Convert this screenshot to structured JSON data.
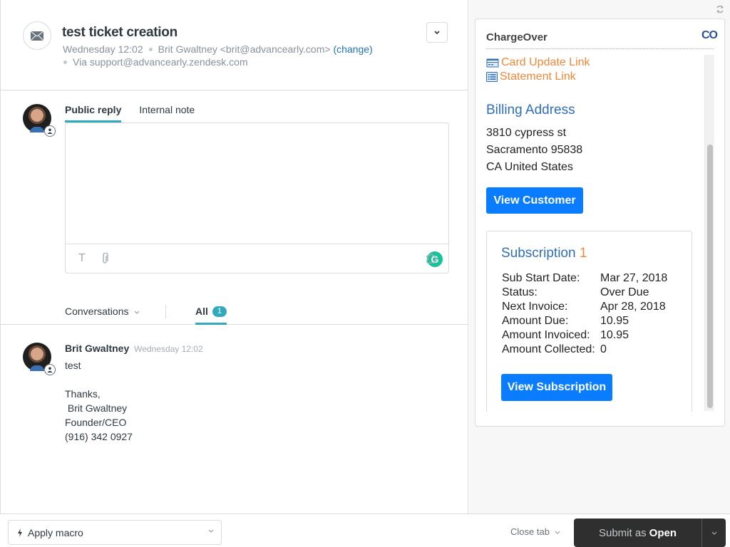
{
  "ticket": {
    "title": "test ticket creation",
    "date": "Wednesday 12:02",
    "requester": "Brit Gwaltney <brit@advancearly.com>",
    "change_label": "(change)",
    "via": "Via support@advancearly.zendesk.com",
    "channel_icon": "envelope-icon"
  },
  "composer": {
    "tabs": [
      {
        "label": "Public reply",
        "active": true
      },
      {
        "label": "Internal note",
        "active": false
      }
    ],
    "body": "",
    "tools": [
      "text-format-icon",
      "attachment-icon",
      "apps-puzzle-icon"
    ]
  },
  "conversations": {
    "filter_label": "Conversations",
    "all_label": "All",
    "all_count": "1"
  },
  "messages": [
    {
      "author": "Brit Gwaltney",
      "time": "Wednesday 12:02",
      "body": "test\n\nThanks,\n Brit Gwaltney\nFounder/CEO\n(916) 342 0927"
    }
  ],
  "app": {
    "title": "ChargeOver",
    "logo": "CO",
    "links": [
      {
        "label": "Card Update Link",
        "icon": "credit-card-icon"
      },
      {
        "label": "Statement Link",
        "icon": "list-icon"
      }
    ],
    "billing": {
      "heading": "Billing Address",
      "line1": "3810 cypress st",
      "line2": "Sacramento 95838",
      "line3": "CA United States"
    },
    "view_customer_label": "View Customer",
    "subscription": {
      "heading": "Subscription",
      "number": "1",
      "rows": [
        {
          "k": "Sub Start Date:",
          "v": "Mar 27, 2018"
        },
        {
          "k": "Status:",
          "v": "Over Due"
        },
        {
          "k": "Next Invoice:",
          "v": "Apr 28, 2018"
        },
        {
          "k": "Amount Due:",
          "v": "10.95"
        },
        {
          "k": "Amount Invoiced:",
          "v": "10.95"
        },
        {
          "k": "Amount Collected:",
          "v": "0"
        }
      ],
      "view_label": "View Subscription"
    }
  },
  "footer": {
    "macro_label": "Apply macro",
    "close_tab_label": "Close tab",
    "submit_prefix": "Submit as",
    "submit_status": "Open"
  },
  "colors": {
    "accent_teal": "#30aabc",
    "link_orange": "#f0883a",
    "heading_blue": "#2f6fba",
    "button_blue": "#0a7cff",
    "submit_dark": "#2f2f2f"
  }
}
